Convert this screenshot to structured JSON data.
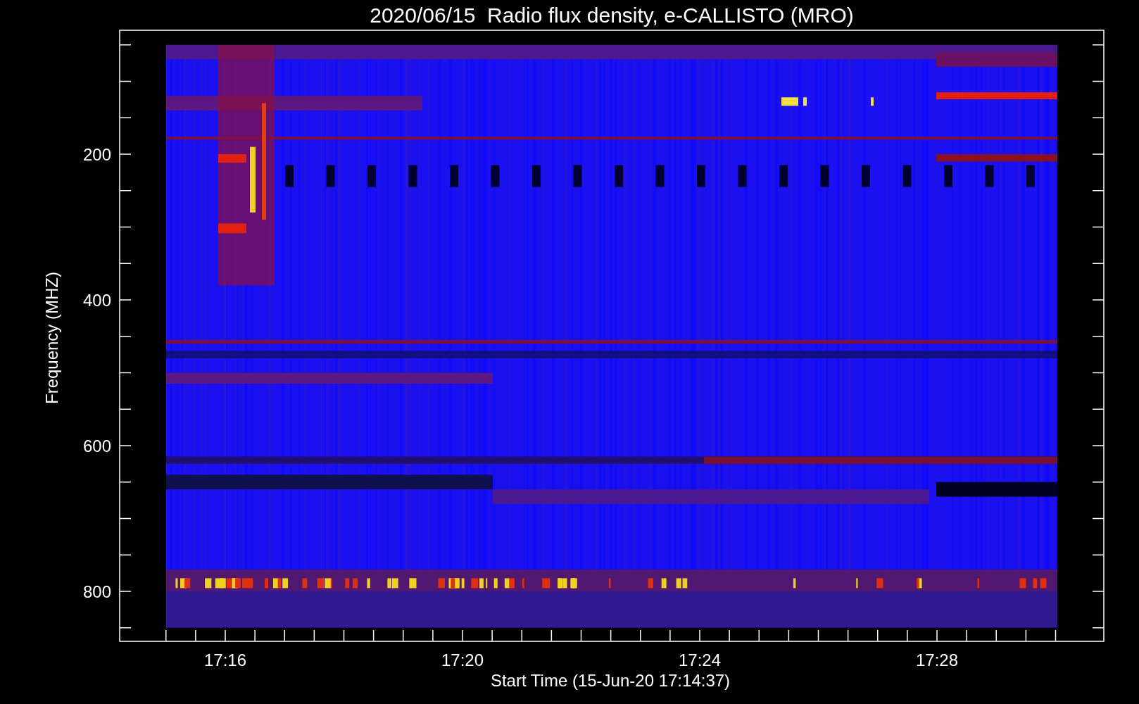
{
  "title": "2020/06/15  Radio flux density, e-CALLISTO (MRO)",
  "chart": {
    "ylabel": "Frequency (MHZ)",
    "xlabel": "Start Time (15-Jun-20 17:14:37)",
    "y_tick_labels": [
      "200",
      "400",
      "600",
      "800"
    ],
    "x_tick_labels": [
      "17:16",
      "17:20",
      "17:24",
      "17:28"
    ]
  }
}
